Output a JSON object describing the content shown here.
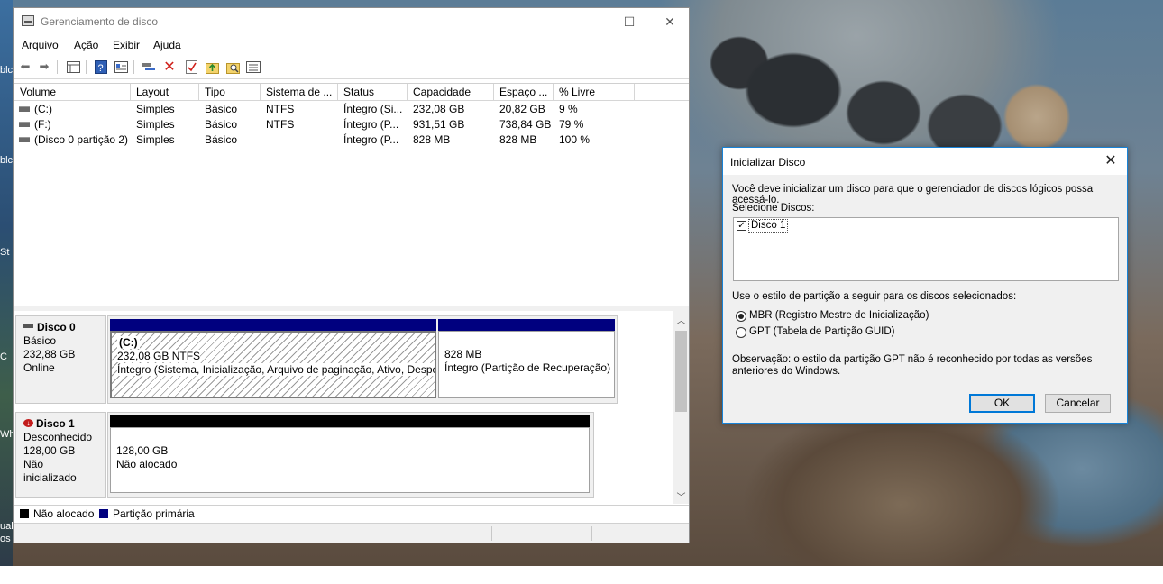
{
  "window": {
    "title": "Gerenciamento de disco",
    "controls": {
      "minimize": "—",
      "maximize": "☐",
      "close": "✕"
    }
  },
  "menu": [
    "Arquivo",
    "Ação",
    "Exibir",
    "Ajuda"
  ],
  "toolbar_icons": [
    "back-arrow-icon",
    "forward-arrow-icon",
    "list-view-icon",
    "help-icon",
    "properties-icon",
    "connect-icon",
    "delete-icon",
    "check-icon",
    "up-folder-icon",
    "search-icon",
    "details-icon"
  ],
  "volume_list": {
    "columns": [
      "Volume",
      "Layout",
      "Tipo",
      "Sistema de ...",
      "Status",
      "Capacidade",
      "Espaço ...",
      "% Livre"
    ],
    "rows": [
      {
        "volume": "(C:)",
        "layout": "Simples",
        "tipo": "Básico",
        "fs": "NTFS",
        "status": "Íntegro (Si...",
        "capacidade": "232,08 GB",
        "espaco": "20,82 GB",
        "livre": "9 %"
      },
      {
        "volume": "(F:)",
        "layout": "Simples",
        "tipo": "Básico",
        "fs": "NTFS",
        "status": "Íntegro (P...",
        "capacidade": "931,51 GB",
        "espaco": "738,84 GB",
        "livre": "79 %"
      },
      {
        "volume": "(Disco 0 partição 2)",
        "layout": "Simples",
        "tipo": "Básico",
        "fs": "",
        "status": "Íntegro (P...",
        "capacidade": "828 MB",
        "espaco": "828 MB",
        "livre": "100 %"
      }
    ]
  },
  "disks": [
    {
      "name": "Disco 0",
      "type": "Básico",
      "size": "232,88 GB",
      "state": "Online",
      "partitions": [
        {
          "label": "(C:)",
          "line1": "232,08 GB NTFS",
          "line2": "Íntegro (Sistema, Inicialização, Arquivo de paginação, Ativo, Despe"
        },
        {
          "line1": "828 MB",
          "line2": "Íntegro (Partição de Recuperação)"
        }
      ]
    },
    {
      "name": "Disco 1",
      "type": "Desconhecido",
      "size": "128,00 GB",
      "state": "Não inicializado",
      "partitions": [
        {
          "line1": "128,00 GB",
          "line2": "Não alocado"
        }
      ]
    }
  ],
  "legend": [
    {
      "label": "Não alocado",
      "color": "#000000"
    },
    {
      "label": "Partição primária",
      "color": "#00007f"
    }
  ],
  "dialog": {
    "title": "Inicializar Disco",
    "intro": "Você deve inicializar um disco para que o gerenciador de discos lógicos possa acessá-lo.",
    "select_label": "Selecione Discos:",
    "disk_item": "Disco 1",
    "style_label": "Use o estilo de partição a seguir para os discos selecionados:",
    "option_mbr": "MBR (Registro Mestre de Inicialização)",
    "option_gpt": "GPT (Tabela de Partição GUID)",
    "note": "Observação: o estilo da partição GPT não é reconhecido por todas as versões anteriores do Windows.",
    "ok": "OK",
    "cancel": "Cancelar"
  },
  "desktop_fragments": [
    "blc",
    "blc",
    "St",
    "C",
    "Wh",
    "ual",
    "os"
  ]
}
